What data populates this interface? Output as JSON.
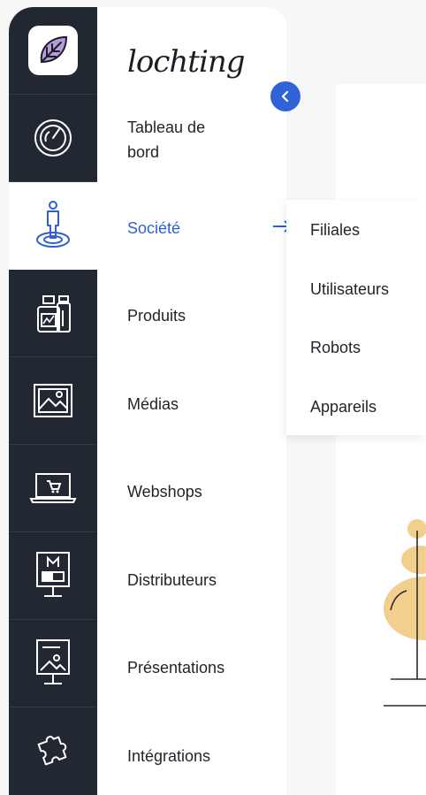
{
  "brand": {
    "name": "lochting"
  },
  "rail": {
    "items": [
      {
        "icon": "leaf-logo-icon"
      },
      {
        "icon": "dashboard-gauge-icon"
      },
      {
        "icon": "person-on-platform-icon"
      },
      {
        "icon": "product-bottles-icon"
      },
      {
        "icon": "image-icon"
      },
      {
        "icon": "laptop-cart-icon"
      },
      {
        "icon": "display-board-icon"
      },
      {
        "icon": "presentation-screen-icon"
      },
      {
        "icon": "puzzle-piece-icon"
      }
    ]
  },
  "nav": {
    "items": [
      {
        "label": "Tableau de bord"
      },
      {
        "label": "Société",
        "active": true
      },
      {
        "label": "Produits"
      },
      {
        "label": "Médias"
      },
      {
        "label": "Webshops"
      },
      {
        "label": "Distributeurs"
      },
      {
        "label": "Présentations"
      },
      {
        "label": "Intégrations"
      }
    ]
  },
  "submenu": {
    "items": [
      {
        "label": "Filiales"
      },
      {
        "label": "Utilisateurs"
      },
      {
        "label": "Robots"
      },
      {
        "label": "Appareils"
      }
    ]
  },
  "colors": {
    "rail_bg": "#222831",
    "accent": "#2f5fd1",
    "collapse_button": "#2e64d8",
    "illustration": "#f2cf8c"
  }
}
